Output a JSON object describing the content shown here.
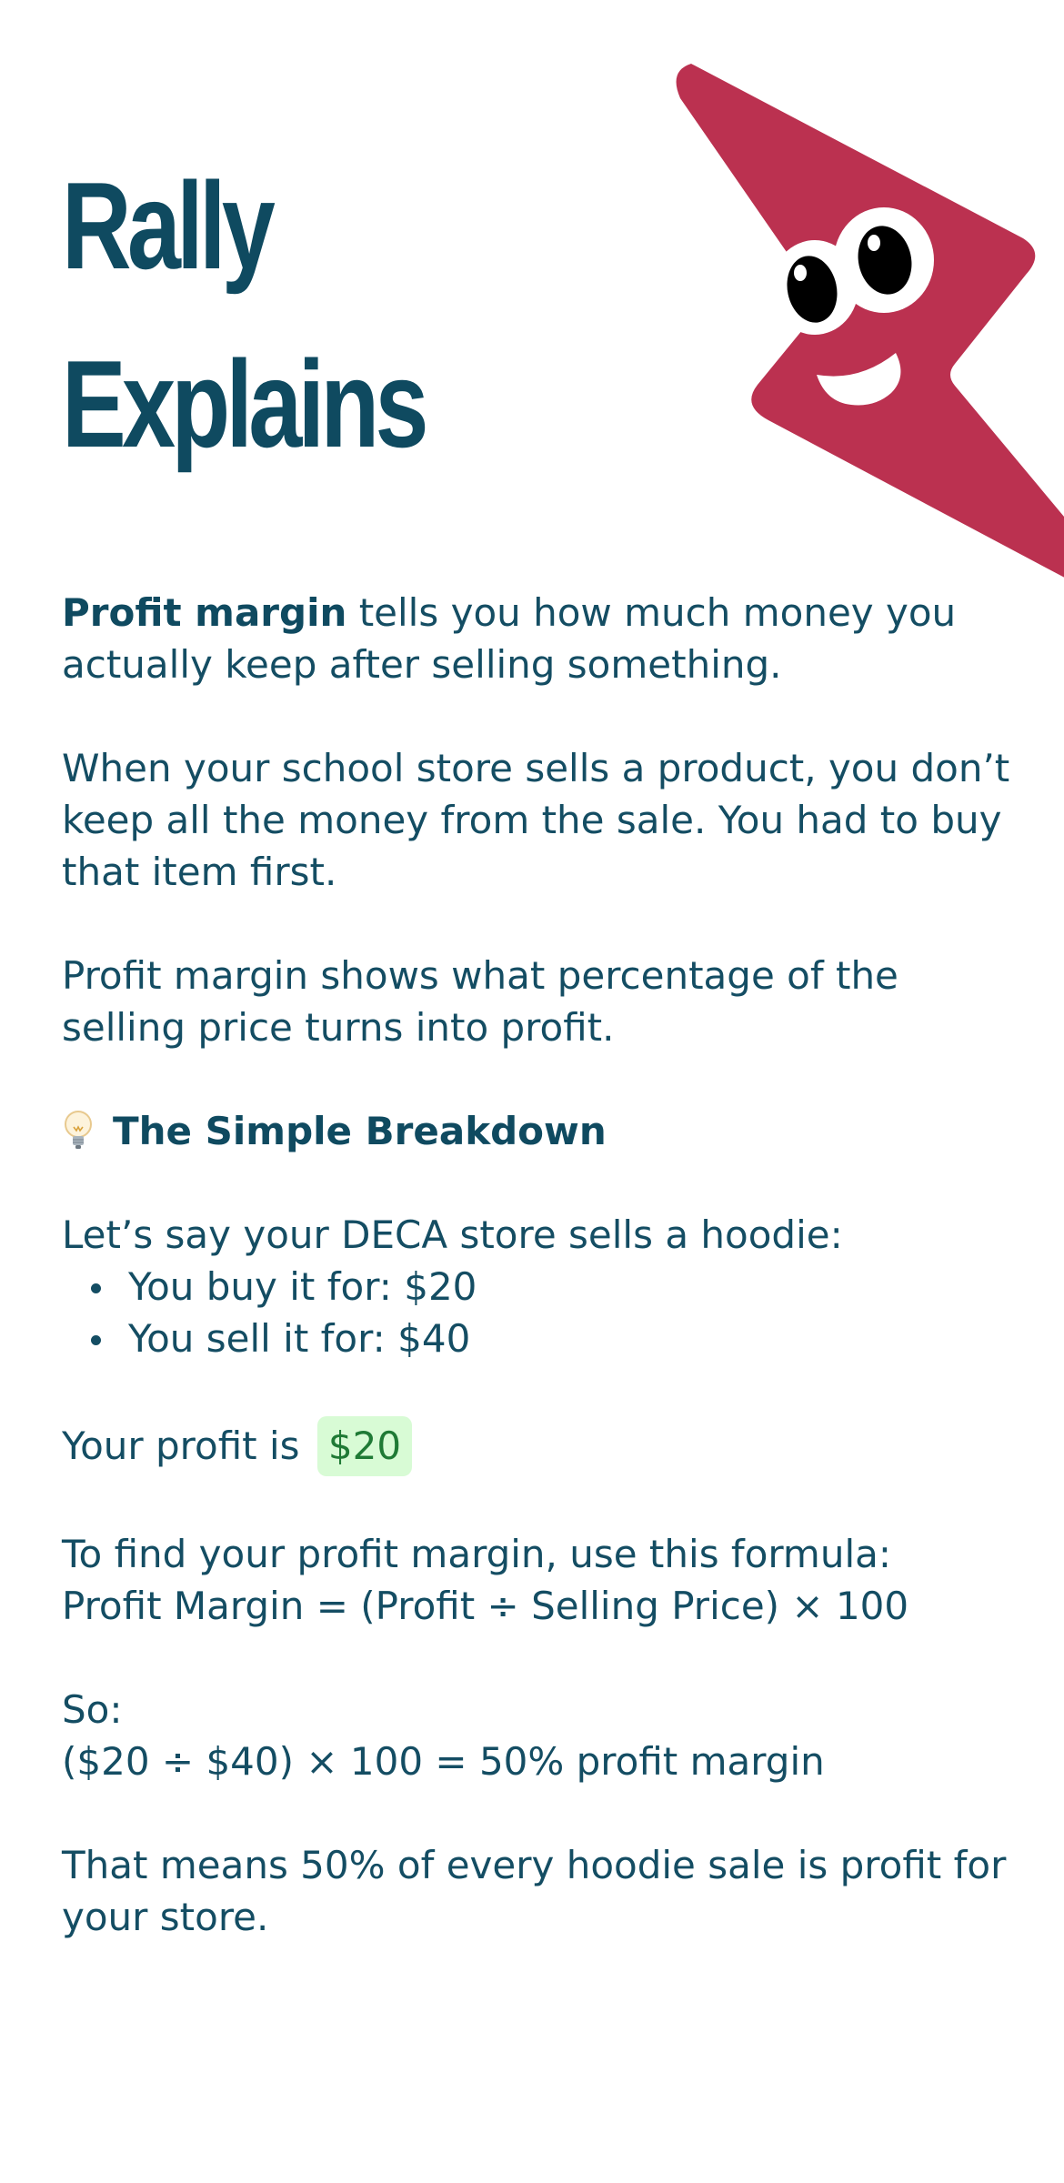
{
  "header": {
    "title_line1": "Rally",
    "title_line2": "Explains"
  },
  "colors": {
    "title": "#0f4a60",
    "body_text": "#144d63",
    "mascot": "#bb3150",
    "highlight_bg": "#d8fbd5",
    "highlight_text": "#1f7a35"
  },
  "mascot": {
    "icon": "lightning-bolt-mascot-icon"
  },
  "intro": {
    "term": "Profit margin",
    "rest": " tells you how much money you actually keep after selling something."
  },
  "paragraph2": "When your school store sells a product, you don’t keep all the money from the sale. You had to buy that item first.",
  "paragraph3": "Profit margin shows what percentage of the selling price turns into profit.",
  "breakdown": {
    "icon": "lightbulb-icon",
    "title": "The Simple Breakdown"
  },
  "example": {
    "intro": "Let’s say your DECA store sells a hoodie:",
    "items": [
      "You buy it for: $20",
      "You sell it for: $40"
    ]
  },
  "profit": {
    "label": "Your profit is",
    "value": "$20"
  },
  "formula": {
    "intro": "To find your profit margin, use this formula:",
    "text": "Profit Margin = (Profit ÷ Selling Price) × 100"
  },
  "calculation": {
    "label": "So:",
    "text": "($20 ÷ $40) × 100 = 50% profit margin"
  },
  "conclusion": "That means 50% of every hoodie sale is profit for your store."
}
